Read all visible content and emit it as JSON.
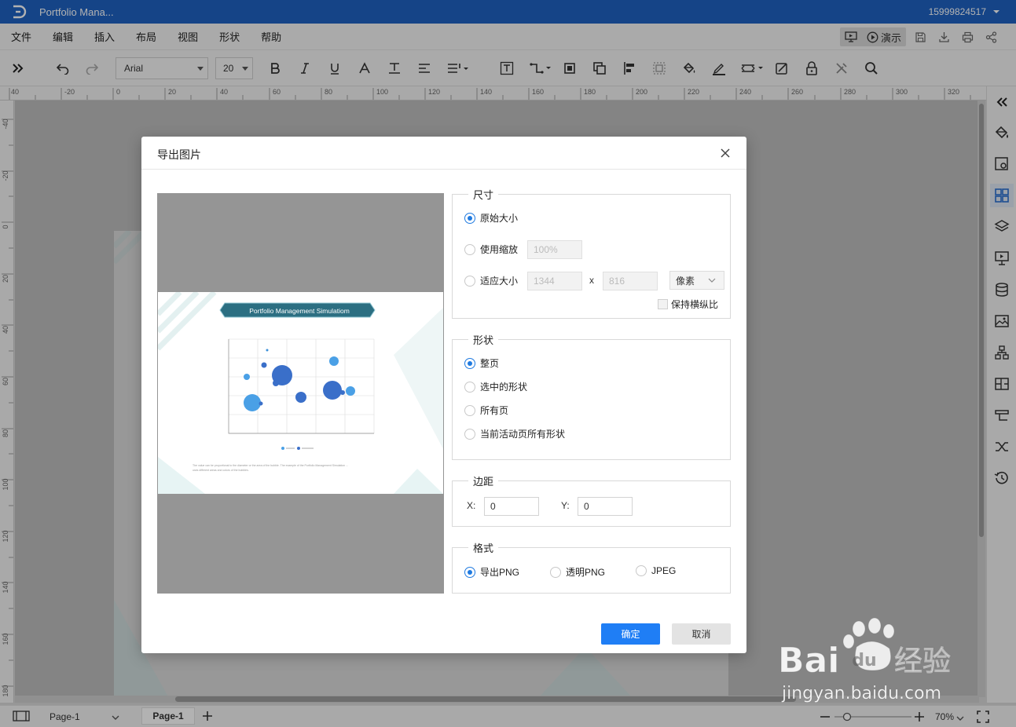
{
  "titlebar": {
    "app_title": "Portfolio Mana...",
    "user": "15999824517"
  },
  "menu": [
    "文件",
    "编辑",
    "插入",
    "布局",
    "视图",
    "形状",
    "帮助"
  ],
  "present": {
    "label": "演示"
  },
  "toolbar": {
    "font": "Arial",
    "size": "20"
  },
  "ruler": {
    "h_labels": [
      "40",
      "-20",
      "0",
      "20",
      "40",
      "60",
      "80",
      "100",
      "120",
      "140",
      "160",
      "180",
      "200",
      "220",
      "240",
      "260",
      "280",
      "300",
      "320"
    ],
    "v_labels": [
      "-40",
      "-20",
      "0",
      "20",
      "40",
      "60",
      "80",
      "100",
      "120",
      "140",
      "160",
      "180"
    ]
  },
  "dialog": {
    "title": "导出图片",
    "size": {
      "legend": "尺寸",
      "original": "原始大小",
      "use_scale": "使用缩放",
      "scale_value": "100%",
      "fit_size": "适应大小",
      "width": "1344",
      "x": "x",
      "height": "816",
      "unit": "像素",
      "keep_ratio": "保持横纵比"
    },
    "shape": {
      "legend": "形状",
      "options": [
        "整页",
        "选中的形状",
        "所有页",
        "当前活动页所有形状"
      ]
    },
    "margin": {
      "legend": "边距",
      "x_label": "X:",
      "x_value": "0",
      "y_label": "Y:",
      "y_value": "0"
    },
    "format": {
      "legend": "格式",
      "options": [
        "导出PNG",
        "透明PNG",
        "JPEG"
      ]
    },
    "ok": "确定",
    "cancel": "取消"
  },
  "preview": {
    "banner": "Portfolio Management Simulatiom",
    "caption": "The value can be proportional to the diameter or the area of the bubble. The example of the Portfolio Management Simulation ...",
    "caption2": "uses different areas and colors of the bubbles."
  },
  "status": {
    "page_select": "Page-1",
    "page_tab": "Page-1",
    "zoom": "70%"
  },
  "watermark": {
    "brand": "Bai",
    "brand2": "经验",
    "url": "jingyan.baidu.com"
  }
}
